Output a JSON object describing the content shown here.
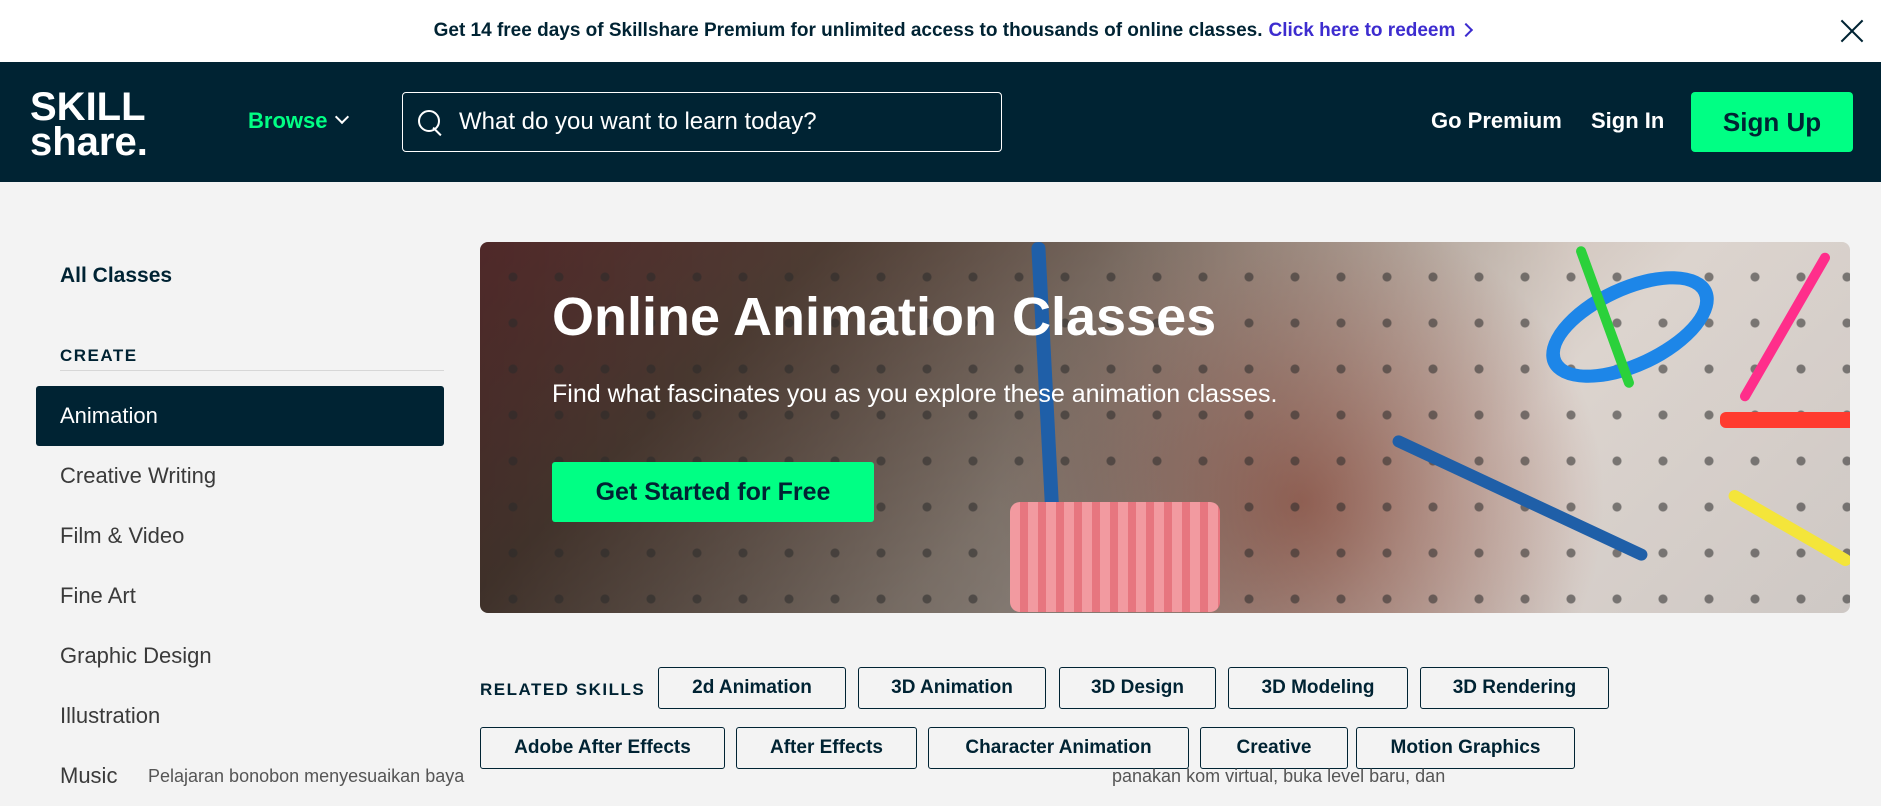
{
  "promo": {
    "text": "Get 14 free days of Skillshare Premium for unlimited access to thousands of online classes.",
    "link": "Click here to redeem"
  },
  "header": {
    "logo_line1": "SKILL",
    "logo_line2": "share.",
    "browse": "Browse",
    "search_placeholder": "What do you want to learn today?",
    "go_premium": "Go Premium",
    "sign_in": "Sign In",
    "sign_up": "Sign Up"
  },
  "sidebar": {
    "all_classes": "All Classes",
    "create_heading": "CREATE",
    "items": [
      {
        "label": "Animation",
        "active": true
      },
      {
        "label": "Creative Writing"
      },
      {
        "label": "Film & Video"
      },
      {
        "label": "Fine Art"
      },
      {
        "label": "Graphic Design"
      },
      {
        "label": "Illustration"
      },
      {
        "label": "Music"
      }
    ]
  },
  "hero": {
    "title": "Online Animation Classes",
    "subtitle": "Find what fascinates you as you explore these animation classes.",
    "cta": "Get Started for Free"
  },
  "related": {
    "label": "RELATED SKILLS",
    "skills": [
      "2d Animation",
      "3D Animation",
      "3D Design",
      "3D Modeling",
      "3D Rendering",
      "Adobe After Effects",
      "After Effects",
      "Character Animation",
      "Creative",
      "Motion Graphics"
    ]
  },
  "footer_peek": {
    "left": "Pelajaran bonobon menyesuaikan baya",
    "right": "panakan kom virtual, buka level baru, dan"
  },
  "colors": {
    "navy": "#002333",
    "green": "#00ff84",
    "link_purple": "#3d2ccf"
  }
}
